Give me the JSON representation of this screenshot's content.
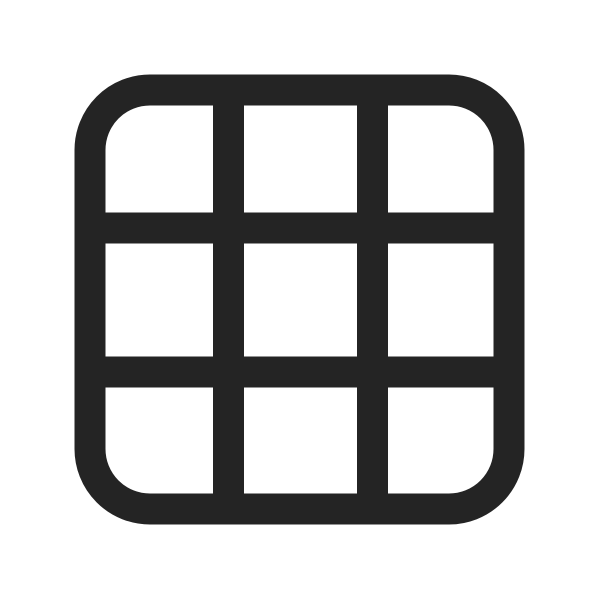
{
  "icon": {
    "name": "grid-icon",
    "stroke_color": "#242424",
    "background_color": "#ffffff",
    "grid": {
      "rows": 3,
      "columns": 3
    }
  }
}
